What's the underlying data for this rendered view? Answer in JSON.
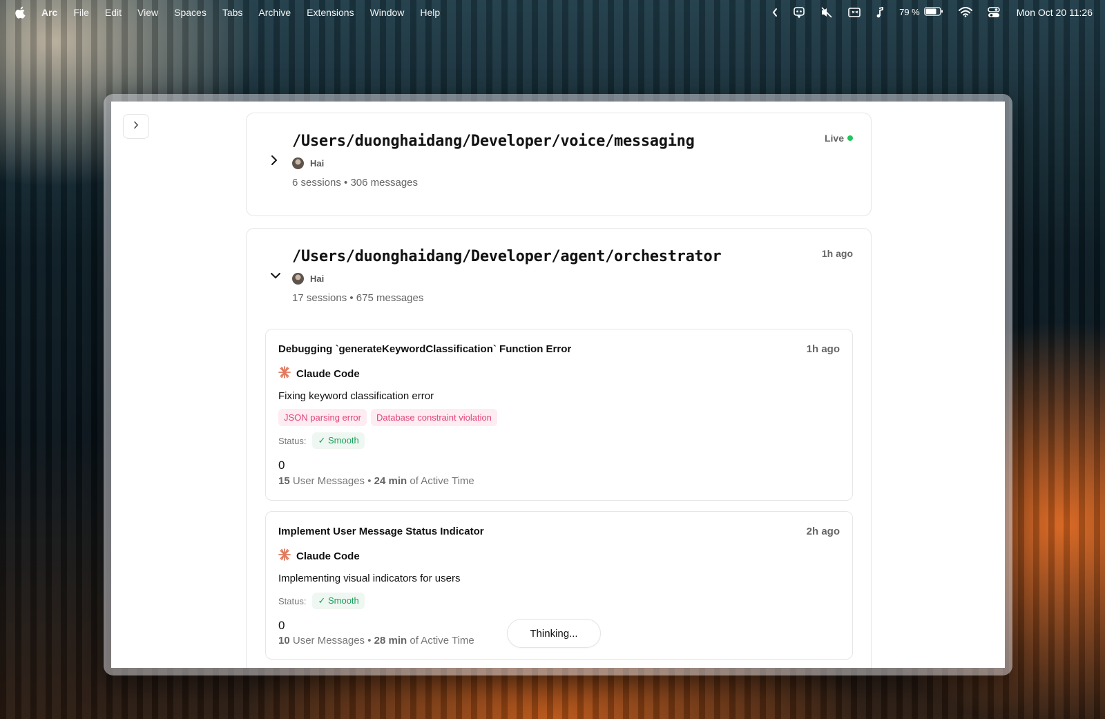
{
  "menubar": {
    "app_name": "Arc",
    "items": [
      "File",
      "Edit",
      "View",
      "Spaces",
      "Tabs",
      "Archive",
      "Extensions",
      "Window",
      "Help"
    ],
    "battery_percent": "79 %",
    "clock": "Mon Oct 20  11:26",
    "status_icons": [
      "chevron-left-icon",
      "ai-assistant-icon",
      "muted-speaker-icon",
      "display-icon",
      "music-note-icon",
      "battery-icon",
      "wifi-icon",
      "control-center-icon"
    ]
  },
  "projects": [
    {
      "path": "/Users/duonghaidang/Developer/voice/messaging",
      "owner": "Hai",
      "stats": "6 sessions • 306 messages",
      "right_label": "Live",
      "expanded": false
    },
    {
      "path": "/Users/duonghaidang/Developer/agent/orchestrator",
      "owner": "Hai",
      "stats": "17 sessions • 675 messages",
      "right_label": "1h ago",
      "expanded": true,
      "sessions": [
        {
          "title": "Debugging `generateKeywordClassification` Function Error",
          "time": "1h ago",
          "agent": "Claude Code",
          "description": "Fixing keyword classification error",
          "tags": [
            "JSON parsing error",
            "Database constraint violation"
          ],
          "status_label": "Status:",
          "status": "✓ Smooth",
          "count": "0",
          "user_messages": "15",
          "user_messages_label": "User Messages",
          "separator": "•",
          "active_time": "24 min",
          "active_time_label": "of Active Time"
        },
        {
          "title": "Implement User Message Status Indicator",
          "time": "2h ago",
          "agent": "Claude Code",
          "description": "Implementing visual indicators for users",
          "status_label": "Status:",
          "status": "✓ Smooth",
          "count": "0",
          "user_messages": "10",
          "user_messages_label": "User Messages",
          "separator": "•",
          "active_time": "28 min",
          "active_time_label": "of Active Time"
        }
      ]
    }
  ],
  "thinking_label": "Thinking...",
  "colors": {
    "live_dot": "#22c55e",
    "tag_text": "#e0457b",
    "tag_bg": "#fdecf1",
    "status_text": "#1e9e5a",
    "claude_accent": "#e07a5f"
  }
}
